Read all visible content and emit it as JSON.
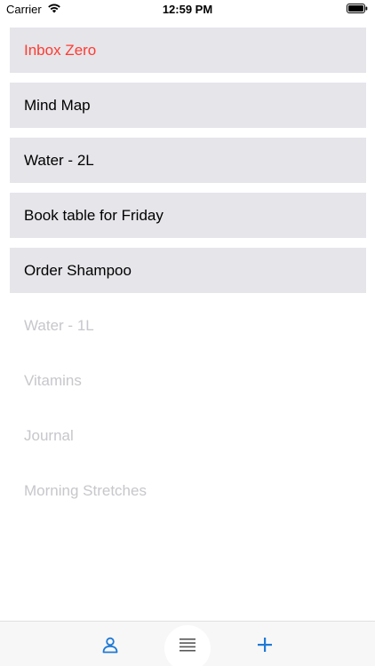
{
  "status_bar": {
    "carrier": "Carrier",
    "time": "12:59 PM"
  },
  "tasks": [
    {
      "label": "Inbox Zero",
      "state": "active",
      "highlight": true
    },
    {
      "label": "Mind Map",
      "state": "active",
      "highlight": false
    },
    {
      "label": "Water - 2L",
      "state": "active",
      "highlight": false
    },
    {
      "label": "Book table for Friday",
      "state": "active",
      "highlight": false
    },
    {
      "label": "Order Shampoo",
      "state": "active",
      "highlight": false
    },
    {
      "label": "Water - 1L",
      "state": "done",
      "highlight": false
    },
    {
      "label": "Vitamins",
      "state": "done",
      "highlight": false
    },
    {
      "label": "Journal",
      "state": "done",
      "highlight": false
    },
    {
      "label": "Morning Stretches",
      "state": "done",
      "highlight": false
    }
  ],
  "tab_bar": {
    "icons": [
      "person-icon",
      "list-icon",
      "plus-icon"
    ]
  },
  "colors": {
    "active_row_bg": "#e5e5ea",
    "done_text": "#c7c7cc",
    "highlight_text": "#ff3b30",
    "accent": "#1f7ad6"
  }
}
